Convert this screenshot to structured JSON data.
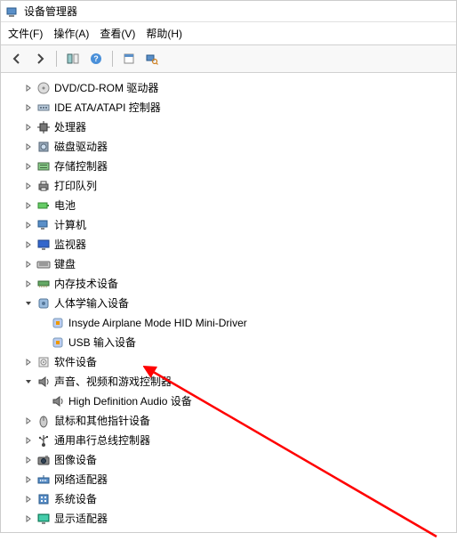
{
  "window": {
    "title": "设备管理器"
  },
  "menubar": {
    "file": "文件(F)",
    "action": "操作(A)",
    "view": "查看(V)",
    "help": "帮助(H)"
  },
  "toolbar": {
    "back": "back",
    "forward": "forward",
    "show": "show-hide",
    "help": "help",
    "properties": "properties",
    "scan": "scan-hardware"
  },
  "tree": [
    {
      "label": "DVD/CD-ROM 驱动器",
      "icon": "disc",
      "depth": 1,
      "chev": "right"
    },
    {
      "label": "IDE ATA/ATAPI 控制器",
      "icon": "ide",
      "depth": 1,
      "chev": "right"
    },
    {
      "label": "处理器",
      "icon": "cpu",
      "depth": 1,
      "chev": "right"
    },
    {
      "label": "磁盘驱动器",
      "icon": "hdd",
      "depth": 1,
      "chev": "right"
    },
    {
      "label": "存储控制器",
      "icon": "storage",
      "depth": 1,
      "chev": "right"
    },
    {
      "label": "打印队列",
      "icon": "printer",
      "depth": 1,
      "chev": "right"
    },
    {
      "label": "电池",
      "icon": "battery",
      "depth": 1,
      "chev": "right"
    },
    {
      "label": "计算机",
      "icon": "computer",
      "depth": 1,
      "chev": "right"
    },
    {
      "label": "监视器",
      "icon": "monitor",
      "depth": 1,
      "chev": "right"
    },
    {
      "label": "键盘",
      "icon": "keyboard",
      "depth": 1,
      "chev": "right"
    },
    {
      "label": "内存技术设备",
      "icon": "memory",
      "depth": 1,
      "chev": "right"
    },
    {
      "label": "人体学输入设备",
      "icon": "hid",
      "depth": 1,
      "chev": "down"
    },
    {
      "label": "Insyde Airplane Mode HID Mini-Driver",
      "icon": "hidchild",
      "depth": 2,
      "chev": "none"
    },
    {
      "label": "USB 输入设备",
      "icon": "hidchild",
      "depth": 2,
      "chev": "none"
    },
    {
      "label": "软件设备",
      "icon": "software",
      "depth": 1,
      "chev": "right"
    },
    {
      "label": "声音、视频和游戏控制器",
      "icon": "audio",
      "depth": 1,
      "chev": "down"
    },
    {
      "label": "High Definition Audio 设备",
      "icon": "audio",
      "depth": 2,
      "chev": "none"
    },
    {
      "label": "鼠标和其他指针设备",
      "icon": "mouse",
      "depth": 1,
      "chev": "right"
    },
    {
      "label": "通用串行总线控制器",
      "icon": "usb",
      "depth": 1,
      "chev": "right"
    },
    {
      "label": "图像设备",
      "icon": "camera",
      "depth": 1,
      "chev": "right"
    },
    {
      "label": "网络适配器",
      "icon": "network",
      "depth": 1,
      "chev": "right"
    },
    {
      "label": "系统设备",
      "icon": "system",
      "depth": 1,
      "chev": "right"
    },
    {
      "label": "显示适配器",
      "icon": "display",
      "depth": 1,
      "chev": "right"
    }
  ]
}
